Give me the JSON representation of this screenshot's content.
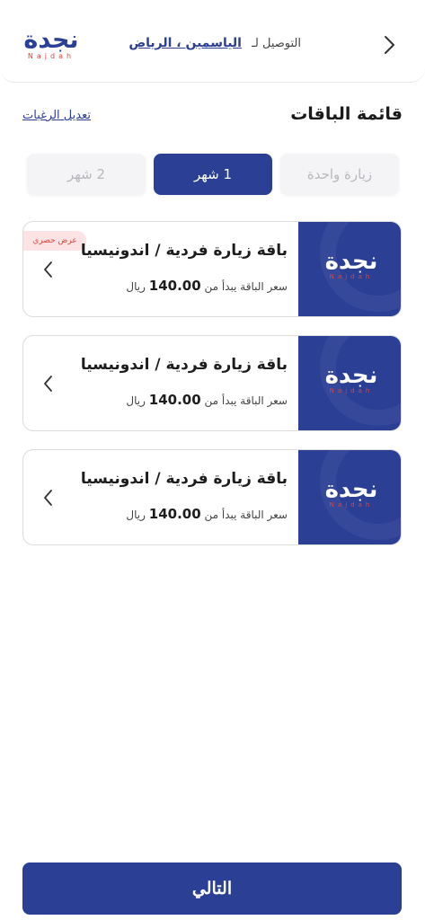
{
  "header": {
    "logo_ar": "نجدة",
    "logo_en": "Najdah",
    "delivery_label": "التوصيل لـ",
    "location": "الياسمين ، الرياض"
  },
  "main": {
    "title": "قائمة الباقات",
    "edit_link": "تعديل الرغبات",
    "tabs": [
      {
        "label": "زيارة واحدة",
        "active": false
      },
      {
        "label": "1 شهر",
        "active": true
      },
      {
        "label": "2 شهر",
        "active": false
      }
    ],
    "packages": [
      {
        "title": "باقة زيارة فردية / اندونيسيا",
        "price_prefix": "سعر الباقة يبدأ من",
        "price": "140.00",
        "currency": "ريال",
        "badge": "عرض حصري"
      },
      {
        "title": "باقة زيارة فردية / اندونيسيا",
        "price_prefix": "سعر الباقة يبدأ من",
        "price": "140.00",
        "currency": "ريال",
        "badge": ""
      },
      {
        "title": "باقة زيارة فردية / اندونيسيا",
        "price_prefix": "سعر الباقة يبدأ من",
        "price": "140.00",
        "currency": "ريال",
        "badge": ""
      }
    ]
  },
  "footer": {
    "next_label": "التالي"
  },
  "colors": {
    "primary": "#2b3f95",
    "accent": "#e0443b",
    "badge_bg": "#fde3e3"
  },
  "icons": {
    "back": "chevron-right-icon",
    "card_arrow": "chevron-left-icon"
  }
}
